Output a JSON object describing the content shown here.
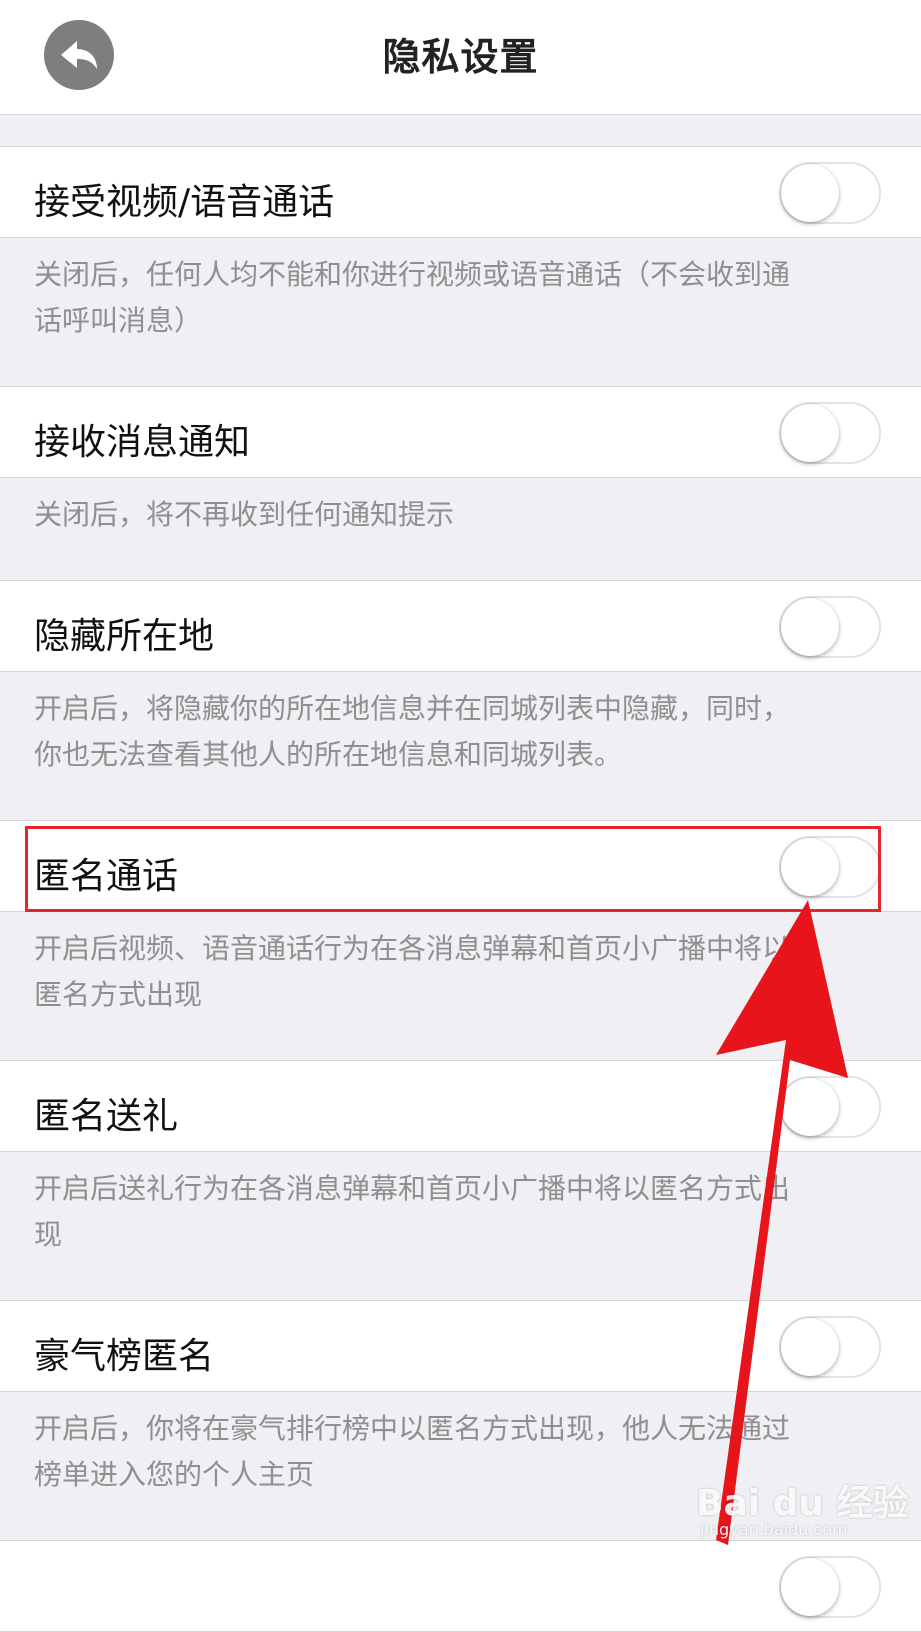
{
  "header": {
    "title": "隐私设置",
    "back_icon": "back-arrow-icon"
  },
  "settings": [
    {
      "label": "接受视频/语音通话",
      "enabled": false,
      "desc_lines": [
        "关闭后，任何人均不能和你进行视频或语音通话（不会收到通",
        "话呼叫消息）"
      ]
    },
    {
      "label": "接收消息通知",
      "enabled": false,
      "desc_lines": [
        "关闭后，将不再收到任何通知提示"
      ]
    },
    {
      "label": "隐藏所在地",
      "enabled": false,
      "desc_lines": [
        "开启后，将隐藏你的所在地信息并在同城列表中隐藏，同时，",
        "你也无法查看其他人的所在地信息和同城列表。"
      ]
    },
    {
      "label": "匿名通话",
      "enabled": false,
      "desc_lines": [
        "开启后视频、语音通话行为在各消息弹幕和首页小广播中将以",
        "匿名方式出现"
      ]
    },
    {
      "label": "匿名送礼",
      "enabled": false,
      "desc_lines": [
        "开启后送礼行为在各消息弹幕和首页小广播中将以匿名方式出",
        "现"
      ]
    },
    {
      "label": "豪气榜匿名",
      "enabled": false,
      "desc_lines": [
        "开启后，你将在豪气排行榜中以匿名方式出现，他人无法通过",
        "榜单进入您的个人主页"
      ]
    }
  ],
  "annotation": {
    "highlight_color": "#e5262c",
    "arrow_color": "#e8141b"
  },
  "watermark": {
    "brand": "Bai du 经验",
    "url": "jingyan.baidu.com"
  }
}
